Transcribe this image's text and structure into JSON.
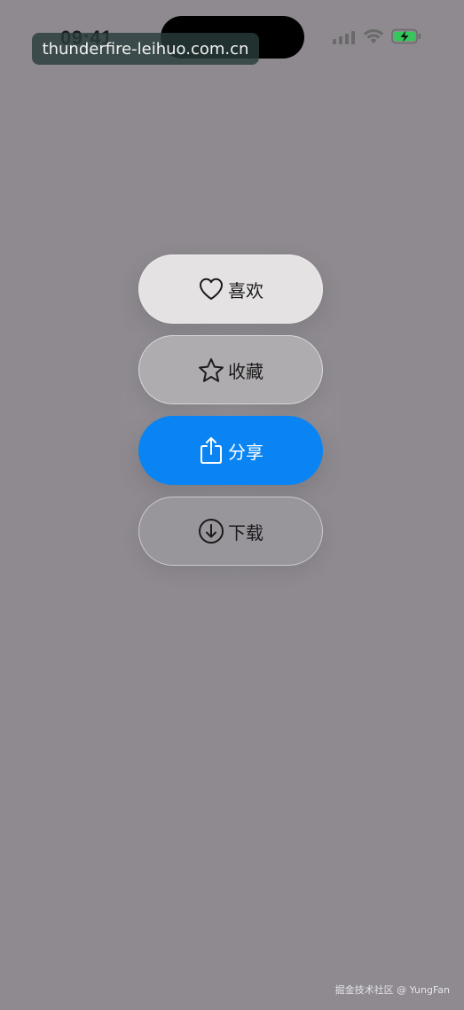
{
  "status_bar": {
    "time": "09:41",
    "watermark": "thunderfire-leihuo.com.cn"
  },
  "menu": {
    "items": [
      {
        "label": "喜欢",
        "icon": "heart-icon"
      },
      {
        "label": "收藏",
        "icon": "star-icon"
      },
      {
        "label": "分享",
        "icon": "share-icon"
      },
      {
        "label": "下载",
        "icon": "download-icon"
      }
    ]
  },
  "footer": {
    "watermark": "掘金技术社区 @ YungFan"
  },
  "colors": {
    "background": "#8e8a90",
    "share_accent": "#0a84f2",
    "battery_green": "#34c759"
  }
}
